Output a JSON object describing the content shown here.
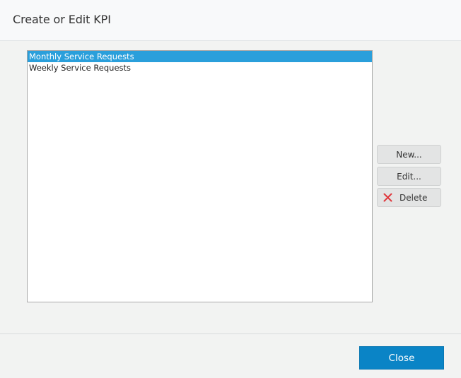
{
  "dialog": {
    "title": "Create or Edit KPI"
  },
  "kpi_list": {
    "items": [
      {
        "label": "Monthly Service Requests",
        "selected": true
      },
      {
        "label": "Weekly Service Requests",
        "selected": false
      }
    ]
  },
  "actions": {
    "new_label": "New...",
    "edit_label": "Edit...",
    "delete_label": "Delete",
    "delete_icon": "red-x-icon"
  },
  "footer": {
    "close_label": "Close"
  },
  "colors": {
    "selection": "#2a9fdb",
    "primary_button": "#0a84c6",
    "delete_icon": "#e0393e"
  }
}
